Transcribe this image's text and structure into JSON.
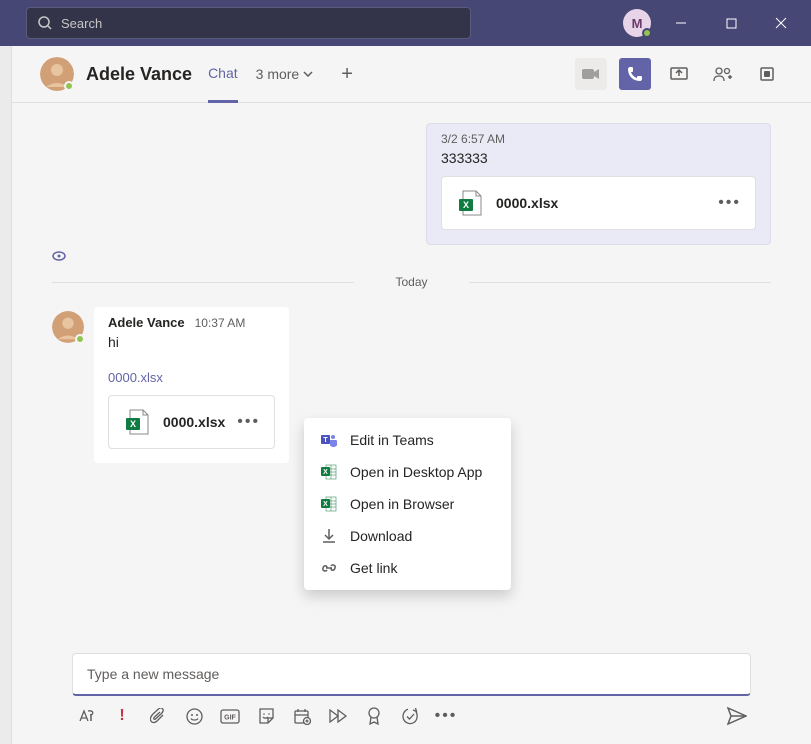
{
  "search": {
    "placeholder": "Search"
  },
  "user_initial": "M",
  "header": {
    "contact_name": "Adele Vance",
    "tab_chat": "Chat",
    "more_tabs": "3 more"
  },
  "messages": {
    "outgoing1": {
      "timestamp": "3/2 6:57 AM",
      "text": "333333",
      "file_name": "0000.xlsx"
    },
    "separator": "Today",
    "incoming1": {
      "sender": "Adele Vance",
      "time": "10:37 AM",
      "text": "hi",
      "file_link": "0000.xlsx",
      "file_name": "0000.xlsx"
    }
  },
  "context_menu": {
    "edit_teams": "Edit in Teams",
    "open_desktop": "Open in Desktop App",
    "open_browser": "Open in Browser",
    "download": "Download",
    "get_link": "Get link"
  },
  "composer": {
    "placeholder": "Type a new message"
  }
}
